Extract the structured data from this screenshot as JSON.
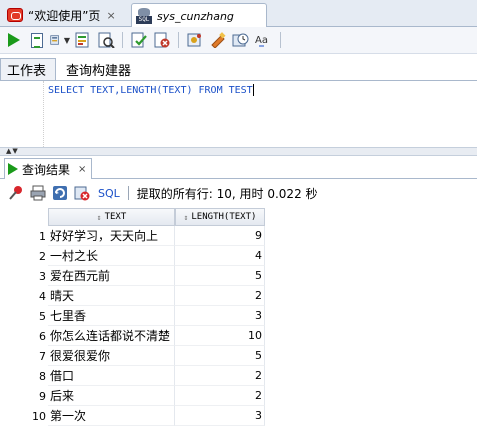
{
  "doc_tabs": [
    {
      "label": "“欢迎使用”页",
      "close": "×"
    },
    {
      "label": "sys_cunzhang",
      "icon_text": "SQL"
    }
  ],
  "toolbar": {
    "icons": [
      "run-statement-icon",
      "run-script-icon",
      "commit-icon",
      "explain-plan-icon",
      "autotrace-icon",
      "rollback-icon",
      "sql-tuning-icon",
      "clear-icon",
      "history-icon",
      "format-icon"
    ]
  },
  "worksheet_tabs": [
    "工作表",
    "查询构建器"
  ],
  "editor": {
    "code": "SELECT TEXT,LENGTH(TEXT) FROM TEST"
  },
  "results": {
    "tab_label": "查询结果",
    "tab_close": "×",
    "sql_label": "SQL",
    "fetch_status": "提取的所有行: 10, 用时 0.022 秒",
    "columns": [
      "TEXT",
      "LENGTH(TEXT)"
    ],
    "rows": [
      {
        "n": "1",
        "text": "好好学习，天天向上",
        "len": "9"
      },
      {
        "n": "2",
        "text": "一村之长",
        "len": "4"
      },
      {
        "n": "3",
        "text": "爱在西元前",
        "len": "5"
      },
      {
        "n": "4",
        "text": "晴天",
        "len": "2"
      },
      {
        "n": "5",
        "text": "七里香",
        "len": "3"
      },
      {
        "n": "6",
        "text": "你怎么连话都说不清楚",
        "len": "10"
      },
      {
        "n": "7",
        "text": "很爱很爱你",
        "len": "5"
      },
      {
        "n": "8",
        "text": "借口",
        "len": "2"
      },
      {
        "n": "9",
        "text": "后来",
        "len": "2"
      },
      {
        "n": "10",
        "text": "第一次",
        "len": "3"
      }
    ]
  }
}
